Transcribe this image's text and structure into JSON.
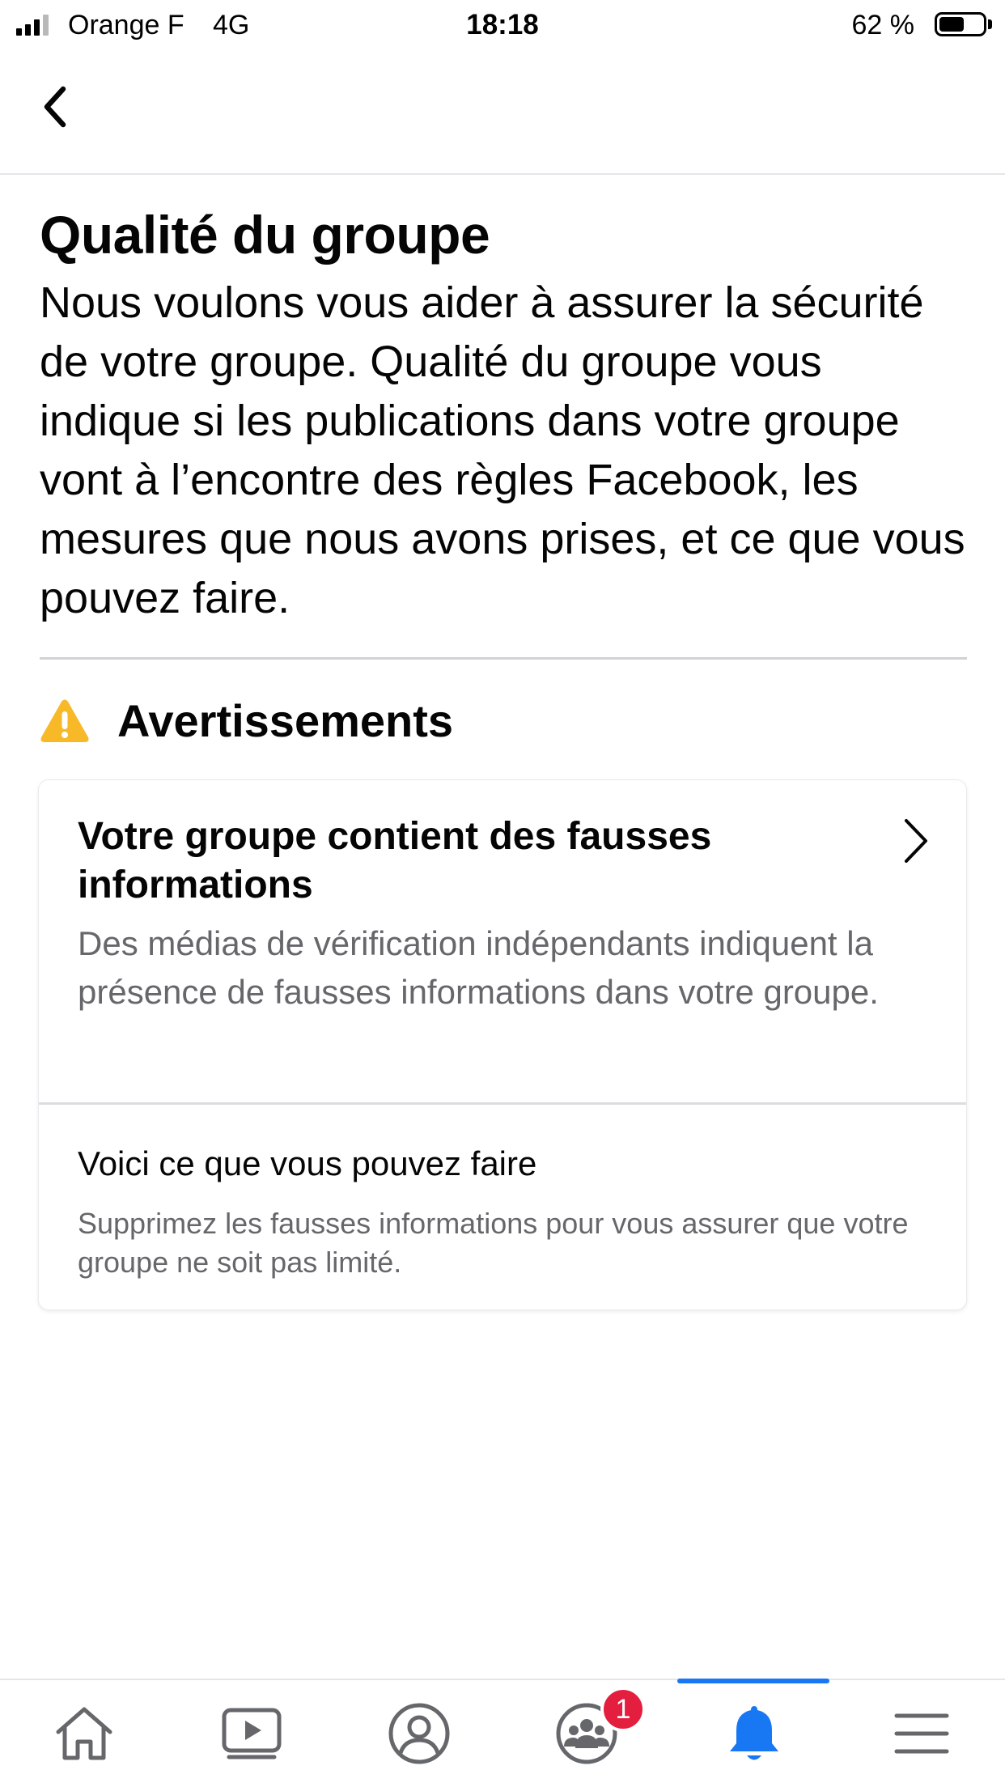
{
  "status_bar": {
    "carrier": "Orange F",
    "network": "4G",
    "time": "18:18",
    "battery_percent": "62 %",
    "battery_level": 0.62
  },
  "header": {
    "back_icon": "chevron-left-icon"
  },
  "page": {
    "title": "Qualité du groupe",
    "description": "Nous voulons vous aider à assurer la sécurité de votre groupe. Qualité du groupe vous indique si les publications dans votre groupe vont à l’encontre des règles Facebook, les mesures que nous avons prises, et ce que vous pouvez faire."
  },
  "warnings_section": {
    "icon": "warning-icon",
    "icon_color": "#f7b928",
    "title": "Avertissements"
  },
  "warning_card": {
    "title": "Votre groupe contient des fausses informations",
    "body": "Des médias de vérification indépendants indiquent la présence de fausses informations dans votre groupe.",
    "action_title": "Voici ce que vous pouvez faire",
    "action_body": "Supprimez les fausses informations pour vous assurer que votre groupe ne soit pas limité."
  },
  "tabbar": {
    "tabs": [
      {
        "icon": "home-icon",
        "active": false
      },
      {
        "icon": "video-icon",
        "active": false
      },
      {
        "icon": "profile-icon",
        "active": false
      },
      {
        "icon": "groups-icon",
        "active": false,
        "badge": "1"
      },
      {
        "icon": "bell-icon",
        "active": true
      },
      {
        "icon": "menu-icon",
        "active": false
      }
    ],
    "active_color": "#1877f2",
    "inactive_color": "#65676b",
    "badge_color": "#e41e3f"
  }
}
